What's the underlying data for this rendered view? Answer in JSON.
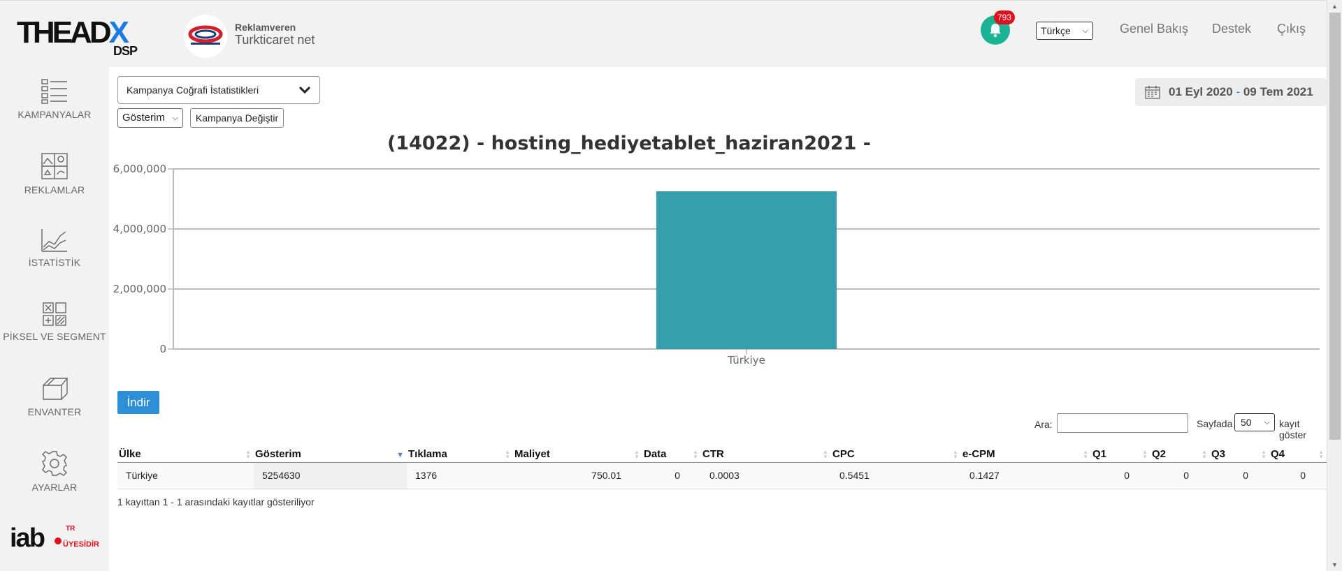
{
  "header": {
    "brand_main": "THEADX",
    "brand_sub": "DSP",
    "advertiser_label": "Reklamveren",
    "advertiser_name": "Turkticaret net",
    "notification_count": "793",
    "language": "Türkçe",
    "nav": [
      "Genel Bakış",
      "Destek",
      "Çıkış"
    ]
  },
  "sidebar": {
    "items": [
      {
        "label": "KAMPANYALAR",
        "icon": "campaign-list-icon"
      },
      {
        "label": "REKLAMLAR",
        "icon": "ads-gallery-icon"
      },
      {
        "label": "İSTATİSTİK",
        "icon": "statistics-chart-icon"
      },
      {
        "label": "PİKSEL VE SEGMENT",
        "icon": "pixel-segment-icon"
      },
      {
        "label": "ENVANTER",
        "icon": "inventory-box-icon"
      },
      {
        "label": "AYARLAR",
        "icon": "settings-gear-icon"
      }
    ],
    "iab_text": "iab",
    "iab_region": "TR",
    "iab_member": "ÜYESİDİR"
  },
  "controls": {
    "report_type": "Kampanya Coğrafi İstatistikleri",
    "metric": "Gösterim",
    "change_campaign": "Kampanya Değiştir",
    "date_start": "01 Eyl 2020",
    "date_sep": "-",
    "date_end": "09 Tem 2021",
    "download": "İndir"
  },
  "chart_data": {
    "type": "bar",
    "title": "(14022) - hosting_hediyetablet_haziran2021 -",
    "categories": [
      "Türkiye"
    ],
    "values": [
      5254630
    ],
    "ylim": [
      0,
      6000000
    ],
    "yticks": [
      "0",
      "2,000,000",
      "4,000,000",
      "6,000,000"
    ],
    "ytick_values": [
      0,
      2000000,
      4000000,
      6000000
    ],
    "grid": true,
    "color": "#369fae"
  },
  "table": {
    "search_label": "Ara:",
    "page_label": "Sayfada",
    "page_size": "50",
    "page_suffix": "kayıt göster",
    "columns": [
      "Ülke",
      "Gösterim",
      "Tıklama",
      "Maliyet",
      "Data",
      "CTR",
      "CPC",
      "e-CPM",
      "Q1",
      "Q2",
      "Q3",
      "Q4"
    ],
    "rows": [
      [
        "Türkiye",
        "5254630",
        "1376",
        "750.01",
        "0",
        "0.0003",
        "0.5451",
        "0.1427",
        "0",
        "0",
        "0",
        "0"
      ]
    ],
    "info": "1 kayıttan 1 - 1 arasındaki kayıtlar gösteriliyor"
  }
}
